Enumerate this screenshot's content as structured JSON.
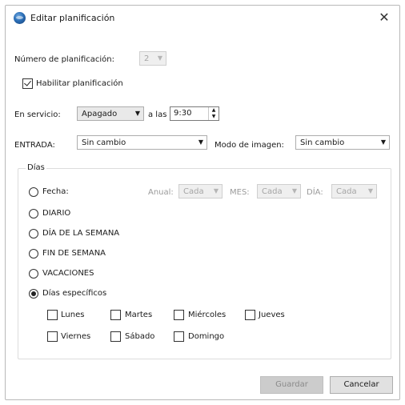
{
  "window": {
    "title": "Editar planificación"
  },
  "schedule_number": {
    "label": "Número de planificación:",
    "value": "2"
  },
  "enable": {
    "label": "Habilitar planificación",
    "checked": true
  },
  "service": {
    "label": "En servicio:",
    "value": "Apagado",
    "at_label": "a las",
    "time": "9:30"
  },
  "input": {
    "label": "ENTRADA:",
    "value": "Sin cambio"
  },
  "image_mode": {
    "label": "Modo de imagen:",
    "value": "Sin cambio"
  },
  "days": {
    "group_label": "Días",
    "date_option": "Fecha:",
    "annual_label": "Anual:",
    "annual_value": "Cada",
    "month_label": "MES:",
    "month_value": "Cada",
    "day_label": "DÍA:",
    "day_value": "Cada",
    "daily": "DIARIO",
    "weekday": "DÍA DE LA SEMANA",
    "weekend": "FIN DE SEMANA",
    "holidays": "VACACIONES",
    "specific": "Días específicos",
    "selected": "specific",
    "weekdays": [
      "Lunes",
      "Martes",
      "Miércoles",
      "Jueves",
      "Viernes",
      "Sábado",
      "Domingo"
    ]
  },
  "buttons": {
    "save": "Guardar",
    "cancel": "Cancelar"
  }
}
